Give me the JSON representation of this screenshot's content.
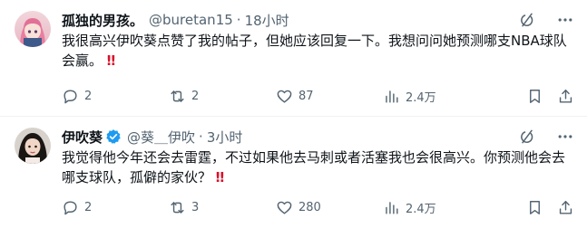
{
  "tweets": [
    {
      "display_name": "孤独的男孩。",
      "handle": "@buretan15",
      "separator": "·",
      "time": "18小时",
      "text": "我很高兴伊吹葵点赞了我的帖子，但她应该回复一下。我想问问她预测哪支NBA球队会赢。",
      "emoji": "‼",
      "reply_count": "2",
      "retweet_count": "2",
      "like_count": "87",
      "view_count": "2.4万",
      "verified": false
    },
    {
      "display_name": "伊吹葵",
      "handle": "@葵＿伊吹",
      "separator": "·",
      "time": "3小时",
      "text": "我觉得他今年还会去雷霆，不过如果他去马刺或者活塞我也会很高兴。你预测他会去哪支球队，孤僻的家伙？",
      "emoji": "‼",
      "reply_count": "2",
      "retweet_count": "3",
      "like_count": "280",
      "view_count": "2.4万",
      "verified": true
    }
  ],
  "colors": {
    "text_primary": "#0f1419",
    "text_secondary": "#536471",
    "verified_blue": "#1d9bf0",
    "emoji_red": "#d9122b",
    "divider": "#eff3f4"
  },
  "icons": [
    "grok-icon",
    "more-icon",
    "reply-icon",
    "retweet-icon",
    "like-icon",
    "views-icon",
    "bookmark-icon",
    "share-icon",
    "verified-badge-icon"
  ]
}
